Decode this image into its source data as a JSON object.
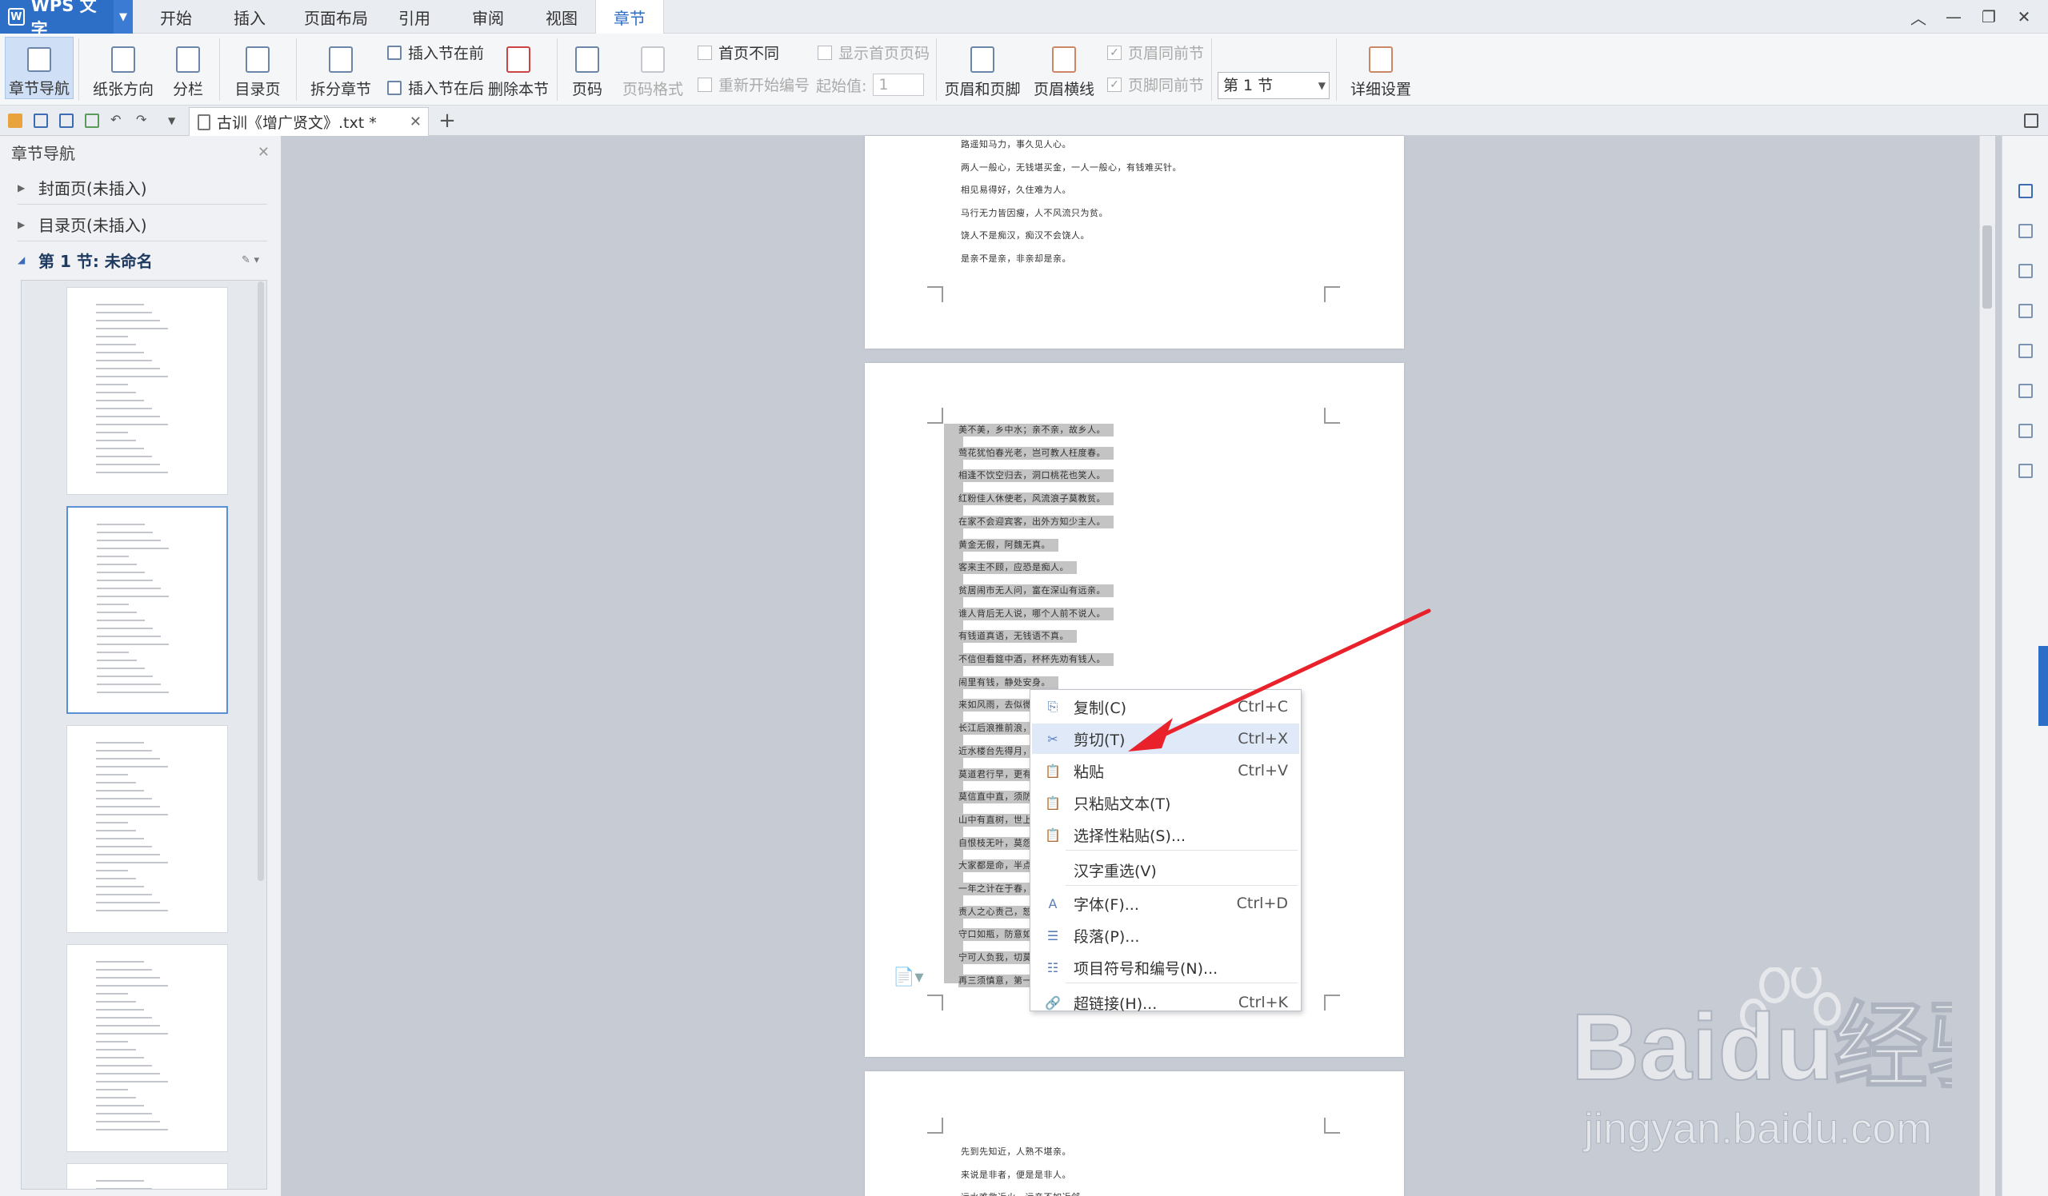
{
  "app": {
    "name": "WPS 文字"
  },
  "menu_tabs": [
    "开始",
    "插入",
    "页面布局",
    "引用",
    "审阅",
    "视图",
    "章节"
  ],
  "active_tab": "章节",
  "ribbon": {
    "section_nav": "章节导航",
    "paper_orientation": "纸张方向",
    "columns": "分栏",
    "toc_page": "目录页",
    "split_section": "拆分章节",
    "insert_before": "插入节在前",
    "insert_after": "插入节在后",
    "delete_section": "删除本节",
    "page_number": "页码",
    "page_number_format": "页码格式",
    "first_page_different": "首页不同",
    "show_first_page_number": "显示首页页码",
    "restart_numbering": "重新开始编号",
    "start_value_label": "起始值:",
    "start_value": "1",
    "header_footer": "页眉和页脚",
    "header_line": "页眉横线",
    "header_same_prev": "页眉同前节",
    "footer_same_prev": "页脚同前节",
    "section_select": "第 1 节",
    "detail_settings": "详细设置"
  },
  "document_tab": {
    "title": "古训《增广贤文》.txt *"
  },
  "nav_pane": {
    "title": "章节导航",
    "items": [
      "封面页(未插入)",
      "目录页(未插入)",
      "第 1 节: 未命名"
    ]
  },
  "page1_lines": [
    "路遥知马力，事久见人心。",
    "两人一般心，无钱堪买金，一人一般心，有钱难买针。",
    "相见易得好，久住难为人。",
    "马行无力皆因瘦，人不风流只为贫。",
    "饶人不是痴汉，痴汉不会饶人。",
    "是亲不是亲，非亲却是亲。"
  ],
  "selected_lines": [
    "美不美，乡中水；亲不亲，故乡人。",
    "莺花犹怕春光老，岂可教人枉度春。",
    "相逢不饮空归去，洞口桃花也笑人。",
    "红粉佳人休使老，风流浪子莫教贫。",
    "在家不会迎宾客，出外方知少主人。",
    "黄金无假，阿魏无真。",
    "客来主不顾，应恐是痴人。",
    "贫居闹市无人问，富在深山有远亲。",
    "谁人背后无人说，哪个人前不说人。",
    "有钱道真语，无钱语不真。",
    "不信但看筵中酒，杯杯先劝有钱人。",
    "闹里有钱，静处安身。",
    "来如风雨，去似微尘。",
    "长江后浪推前浪，",
    "近水楼台先得月，",
    "莫道君行早，更有",
    "莫信直中直，须防",
    "山中有直树，世上",
    "自恨枝无叶，莫怨",
    "大家都是命，半点",
    "一年之计在于春，",
    "责人之心责己，恕",
    "守口如瓶，防意如",
    "宁可人负我，切莫",
    "再三须慎意，第一"
  ],
  "page3_lines": [
    "先到先知近，人熟不堪亲。",
    "来说是非者，便是是非人。",
    "远水难救近火，远亲不如近邻。"
  ],
  "context_menu": {
    "items": [
      {
        "label": "复制(C)",
        "shortcut": "Ctrl+C",
        "icon": "copy-icon"
      },
      {
        "label": "剪切(T)",
        "shortcut": "Ctrl+X",
        "icon": "scissors-icon"
      },
      {
        "label": "粘贴",
        "shortcut": "Ctrl+V",
        "icon": "paste-icon"
      },
      {
        "label": "只粘贴文本(T)",
        "shortcut": "",
        "icon": "paste-text-icon"
      },
      {
        "label": "选择性粘贴(S)...",
        "shortcut": "",
        "icon": "paste-special-icon"
      },
      {
        "label": "汉字重选(V)",
        "shortcut": "",
        "icon": ""
      },
      {
        "label": "字体(F)...",
        "shortcut": "Ctrl+D",
        "icon": "font-icon"
      },
      {
        "label": "段落(P)...",
        "shortcut": "",
        "icon": "paragraph-icon"
      },
      {
        "label": "项目符号和编号(N)...",
        "shortcut": "",
        "icon": "bullets-icon"
      },
      {
        "label": "超链接(H)...",
        "shortcut": "Ctrl+K",
        "icon": "hyperlink-icon"
      }
    ],
    "highlighted": "剪切(T)"
  },
  "watermark": {
    "brand": "Baidu经验",
    "url": "jingyan.baidu.com"
  },
  "colors": {
    "accent": "#2d6ec7",
    "annotation": "#e8212b",
    "selection": "#c4c4c4"
  }
}
